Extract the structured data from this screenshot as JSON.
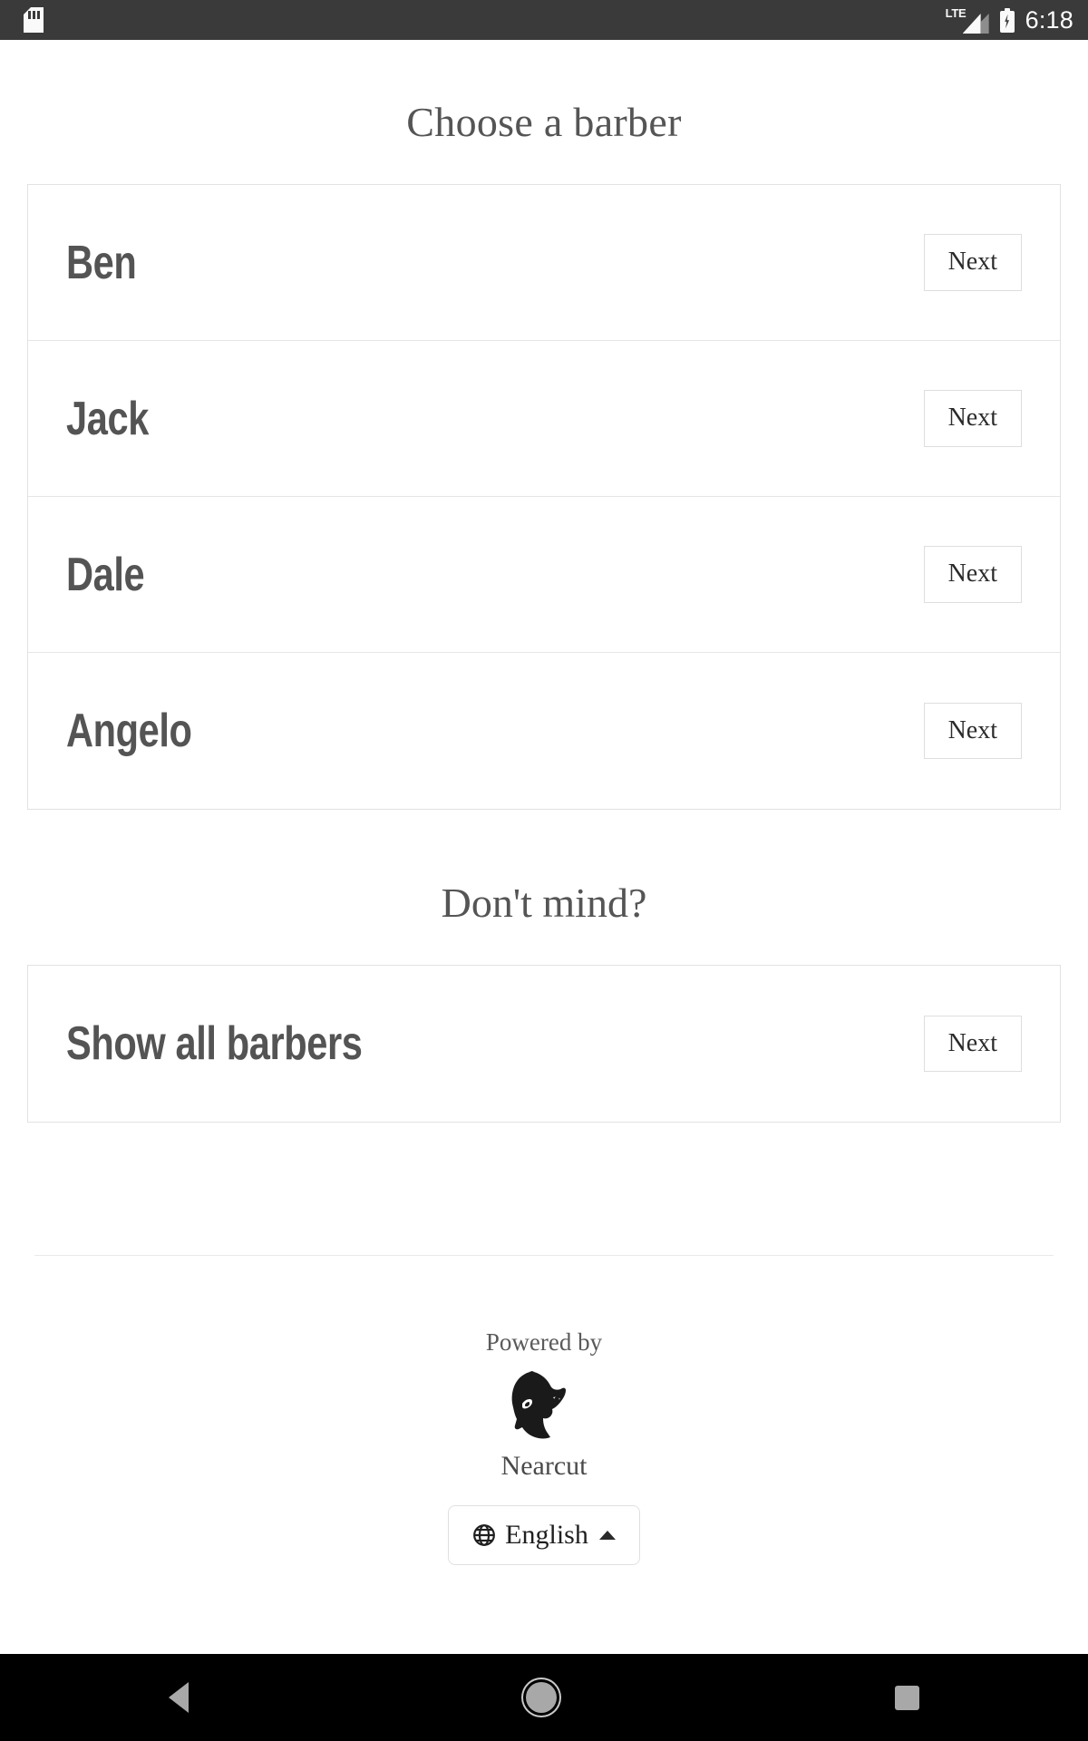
{
  "status_bar": {
    "notification_icon": "sdcard-icon",
    "network_label": "LTE",
    "battery_icon": "battery-charging-icon",
    "clock": "6:18"
  },
  "page": {
    "title": "Choose a barber",
    "subtitle": "Don't mind?"
  },
  "barbers": [
    {
      "name": "Ben",
      "action_label": "Next"
    },
    {
      "name": "Jack",
      "action_label": "Next"
    },
    {
      "name": "Dale",
      "action_label": "Next"
    },
    {
      "name": "Angelo",
      "action_label": "Next"
    }
  ],
  "show_all": {
    "name": "Show all barbers",
    "action_label": "Next"
  },
  "footer": {
    "powered_by": "Powered by",
    "brand_name": "Nearcut",
    "brand_logo_icon": "bearded-man-logo-icon",
    "language": {
      "globe_icon": "globe-icon",
      "label": "English",
      "caret_icon": "caret-up-icon"
    }
  },
  "nav_bar": {
    "back_icon": "back-triangle-icon",
    "home_icon": "home-circle-icon",
    "recents_icon": "recents-square-icon"
  },
  "colors": {
    "status_bar_bg": "#3a3a3a",
    "nav_bar_bg": "#000000",
    "page_bg": "#ffffff",
    "text_primary": "#545454",
    "text_serif": "#555555",
    "border": "#e2e2e2"
  }
}
